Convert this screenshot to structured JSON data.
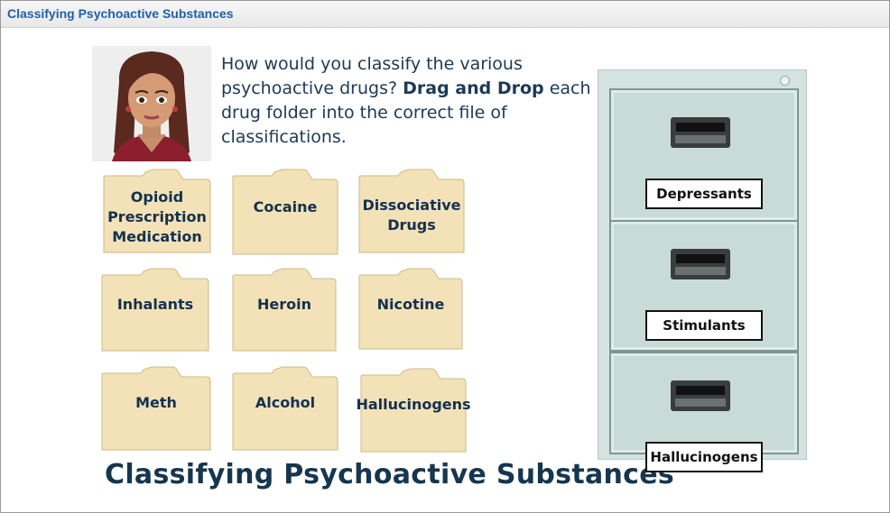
{
  "window": {
    "title": "Classifying Psychoactive Substances"
  },
  "prompt": {
    "part1": "How would you classify the various psychoactive drugs? ",
    "bold": "Drag and Drop",
    "part2": " each drug folder into the correct file of classifications."
  },
  "folders": [
    {
      "label": "Opioid Prescription Medication"
    },
    {
      "label": "Cocaine"
    },
    {
      "label": "Dissociative Drugs"
    },
    {
      "label": "Inhalants"
    },
    {
      "label": "Heroin"
    },
    {
      "label": "Nicotine"
    },
    {
      "label": "Meth"
    },
    {
      "label": "Alcohol"
    },
    {
      "label": "Hallucinogens"
    }
  ],
  "heading": "Classifying Psychoactive Substances",
  "cabinet": {
    "drawers": [
      {
        "label": "Depressants"
      },
      {
        "label": "Stimulants"
      },
      {
        "label": "Hallucinogens"
      }
    ]
  },
  "colors": {
    "title": "#1f5fa8",
    "text": "#1c3a56",
    "folder": "#f3e2b8",
    "cabinet": "#d4e3df"
  }
}
